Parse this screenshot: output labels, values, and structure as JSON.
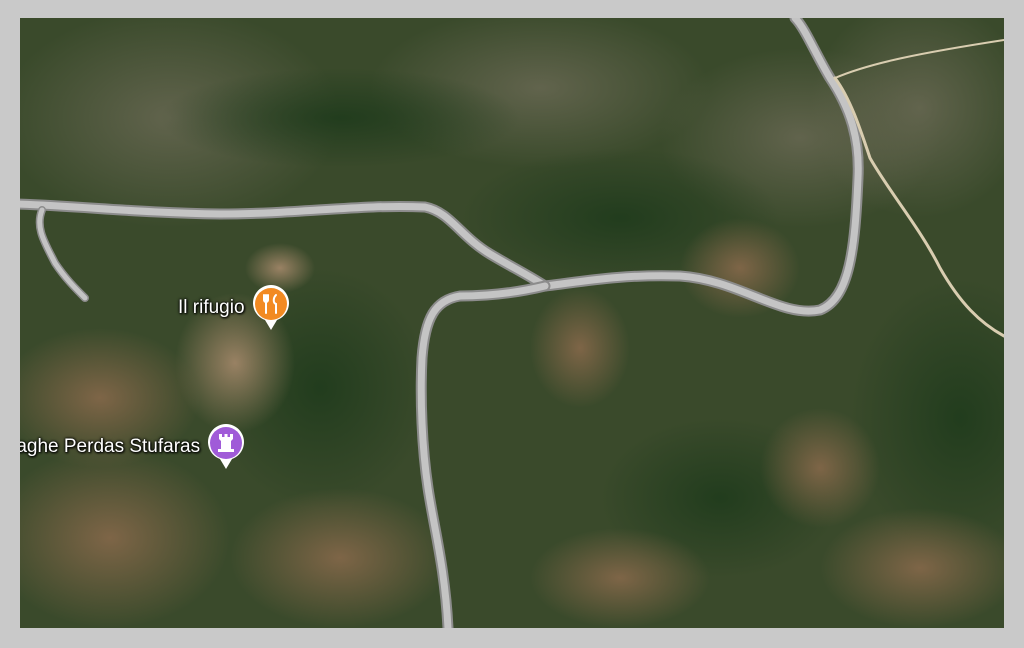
{
  "map": {
    "view": "satellite",
    "pois": [
      {
        "label": "Il rifugio",
        "icon": "fork-knife-icon",
        "category": "restaurant",
        "color": "#f28a22"
      },
      {
        "label": "raghe Perdas Stufaras",
        "icon": "castle-tower-icon",
        "category": "historical site",
        "color": "#a05bd8"
      }
    ]
  },
  "colors": {
    "road": "#bdbdbd",
    "frame": "#c9c9c9"
  }
}
